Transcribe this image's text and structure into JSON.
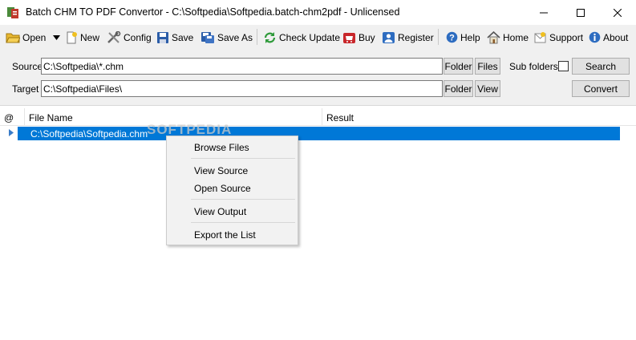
{
  "window": {
    "title": "Batch CHM TO PDF Convertor - C:\\Softpedia\\Softpedia.batch-chm2pdf - Unlicensed",
    "controls": [
      "minimize-icon",
      "maximize-icon",
      "close-icon"
    ]
  },
  "toolbar": {
    "open": "Open",
    "new": "New",
    "config": "Config",
    "save": "Save",
    "save_as": "Save As",
    "check_update": "Check Update",
    "buy": "Buy",
    "register": "Register",
    "help": "Help",
    "home": "Home",
    "support": "Support",
    "about": "About"
  },
  "source": {
    "label": "Source",
    "value": "C:\\Softpedia\\*.chm",
    "folder_btn": "Folder",
    "files_btn": "Files",
    "subfolders_label": "Sub folders",
    "subfolders_checked": false,
    "search_btn": "Search"
  },
  "target": {
    "label": "Target",
    "value": "C:\\Softpedia\\Files\\",
    "folder_btn": "Folder",
    "view_btn": "View",
    "convert_btn": "Convert"
  },
  "list": {
    "columns": [
      "@",
      "File Name",
      "Result"
    ],
    "rows": [
      {
        "file": "C:\\Softpedia\\Softpedia.chm",
        "result": "",
        "selected": true
      }
    ]
  },
  "watermark": "SOFTPEDIA",
  "context_menu": {
    "items": [
      "Browse Files",
      "View  Source",
      "Open Source",
      "View  Output",
      "Export the List"
    ]
  },
  "colors": {
    "selection": "#0078d7",
    "toolbar_bg": "#f0f0f0",
    "menu_bg": "#f2f2f2"
  }
}
